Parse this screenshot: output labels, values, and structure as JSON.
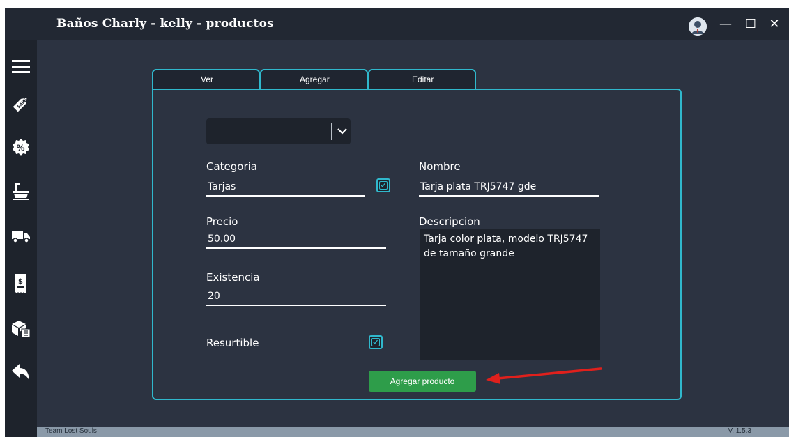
{
  "window": {
    "title": "Baños Charly - kelly - productos",
    "controls": {
      "minimize": "—",
      "maximize": "☐",
      "close": "✕"
    }
  },
  "sidebar": {
    "items": [
      {
        "name": "menu",
        "icon": "hamburger-icon"
      },
      {
        "name": "sales",
        "icon": "sale-tag-icon"
      },
      {
        "name": "discounts",
        "icon": "percent-badge-icon"
      },
      {
        "name": "products",
        "icon": "bathtub-icon"
      },
      {
        "name": "delivery",
        "icon": "truck-icon"
      },
      {
        "name": "receipts",
        "icon": "receipt-icon"
      },
      {
        "name": "inventory",
        "icon": "boxes-icon"
      },
      {
        "name": "back",
        "icon": "back-arrow-icon"
      }
    ]
  },
  "tabs": [
    {
      "label": "Ver"
    },
    {
      "label": "Agregar"
    },
    {
      "label": "Editar"
    }
  ],
  "form": {
    "categoria_label": "Categoria",
    "categoria_value": "Tarjas",
    "nombre_label": "Nombre",
    "nombre_value": "Tarja plata TRJ5747 gde",
    "precio_label": "Precio",
    "precio_value": "50.00",
    "descripcion_label": "Descripcion",
    "descripcion_value": "Tarja color plata, modelo TRJ5747 de tamaño grande",
    "existencia_label": "Existencia",
    "existencia_value": "20",
    "resurtible_label": "Resurtible",
    "categoria_checked": true,
    "resurtible_checked": true,
    "submit_label": "Agregar producto"
  },
  "statusbar": {
    "left": "Team Lost Souls",
    "right": "V. 1.5.3"
  },
  "colors": {
    "accent": "#30b8cc",
    "primary_button": "#2e9d4a",
    "annotation_arrow": "#e0201c"
  }
}
